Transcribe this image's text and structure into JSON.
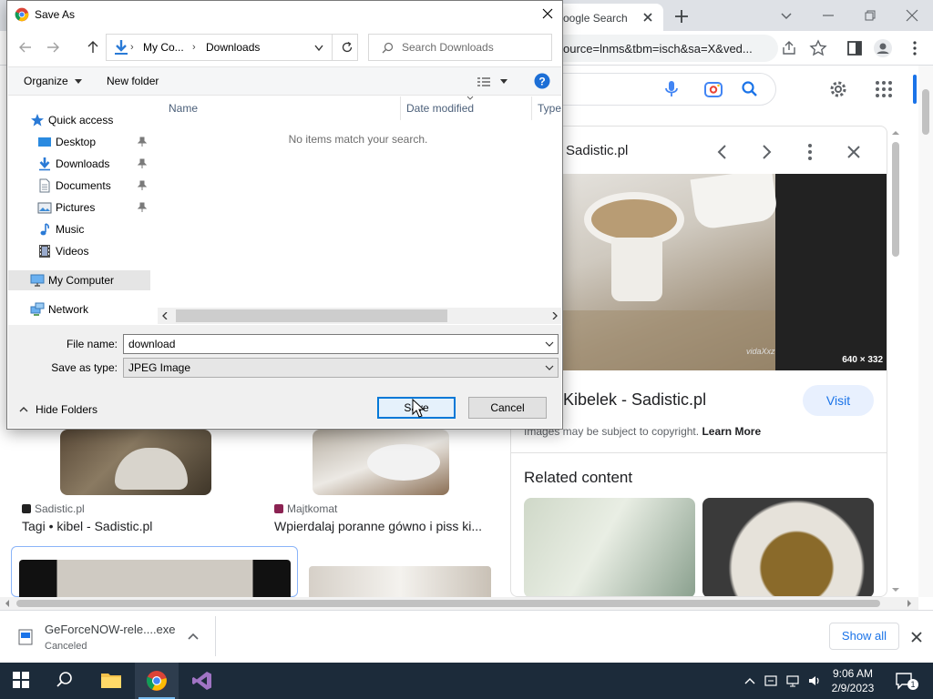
{
  "browser": {
    "tab_title": "oogle Search",
    "url_fragment": "ource=lnms&tbm=isch&sa=X&ved..."
  },
  "results": [
    {
      "source": "Sadistic.pl",
      "title": "Tagi • kibel - Sadistic.pl"
    },
    {
      "source": "Majtkomat",
      "title": "Wpierdalaj poranne gówno i piss ki..."
    }
  ],
  "side_panel": {
    "site": "Sadistic.pl",
    "image_dims": "640 × 332",
    "watermark": "vidaXxz",
    "title": "D] Kibelek - Sadistic.pl",
    "visit_label": "Visit",
    "copyright_text": "Images may be subject to copyright.",
    "learn_more": "Learn More",
    "related_heading": "Related content"
  },
  "download_bar": {
    "file_name": "GeForceNOW-rele....exe",
    "status": "Canceled",
    "show_all": "Show all"
  },
  "taskbar": {
    "time": "9:06 AM",
    "date": "2/9/2023",
    "notification_count": "1"
  },
  "dialog": {
    "title": "Save As",
    "breadcrumb": [
      "My Co...",
      "Downloads"
    ],
    "search_placeholder": "Search Downloads",
    "organize_label": "Organize",
    "new_folder_label": "New folder",
    "tree": [
      {
        "label": "Quick access",
        "icon": "star-icon",
        "pinned": false
      },
      {
        "label": "Desktop",
        "icon": "desktop-icon",
        "pinned": true
      },
      {
        "label": "Downloads",
        "icon": "download-arrow-icon",
        "pinned": true
      },
      {
        "label": "Documents",
        "icon": "document-icon",
        "pinned": true
      },
      {
        "label": "Pictures",
        "icon": "pictures-icon",
        "pinned": true
      },
      {
        "label": "Music",
        "icon": "music-note-icon",
        "pinned": false
      },
      {
        "label": "Videos",
        "icon": "film-icon",
        "pinned": false
      },
      {
        "label": "My Computer",
        "icon": "computer-icon",
        "pinned": false
      },
      {
        "label": "Network",
        "icon": "network-icon",
        "pinned": false
      }
    ],
    "columns": [
      "Name",
      "Date modified",
      "Type"
    ],
    "empty_message": "No items match your search.",
    "file_name_label": "File name:",
    "file_name_value": "download",
    "save_type_label": "Save as type:",
    "save_type_value": "JPEG Image",
    "hide_folders_label": "Hide Folders",
    "save_label": "Save",
    "cancel_label": "Cancel"
  },
  "colors": {
    "chrome_accent": "#1a73e8",
    "dialog_default_border": "#0078d7",
    "taskbar_bg": "#1c2b3a"
  }
}
